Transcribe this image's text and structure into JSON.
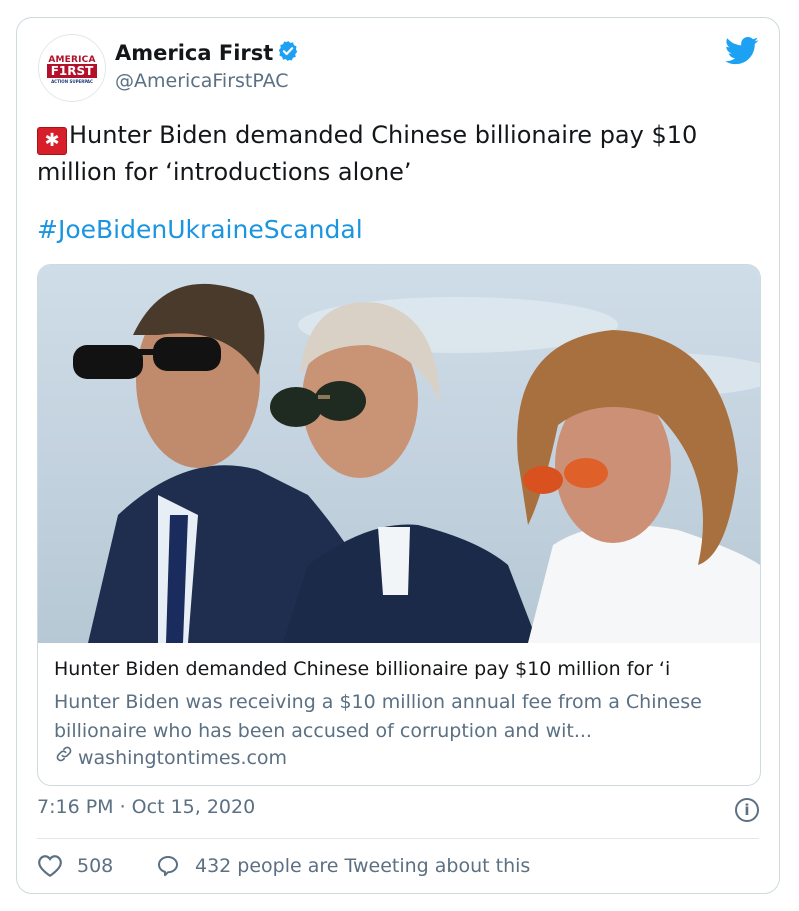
{
  "account": {
    "name": "America First",
    "handle": "@AmericaFirstPAC",
    "logo_top": "AMERICA",
    "logo_main": "F1RST",
    "logo_sub": "ACTION SUPERPAC"
  },
  "tweet": {
    "text": "Hunter Biden demanded Chinese billionaire pay $10 million for ‘introductions alone’",
    "hashtag": "#JoeBidenUkraineScandal",
    "timestamp": "7:16 PM · Oct 15, 2020"
  },
  "link_card": {
    "title": "Hunter Biden demanded Chinese billionaire pay $10 million for ‘i",
    "description": "Hunter Biden was receiving a $10 million annual fee from a Chinese billionaire who has been accused of corruption and wit...",
    "domain": "washingtontimes.com"
  },
  "engagement": {
    "likes": "508",
    "replies_text": "432 people are Tweeting about this"
  },
  "icons": {
    "verified": "verified-badge-icon",
    "platform": "twitter-bird-icon",
    "alert": "siren-emoji-icon",
    "link": "link-icon",
    "info": "info-icon",
    "like": "heart-icon",
    "reply": "speech-bubble-icon"
  },
  "colors": {
    "link_blue": "#1b95e0",
    "secondary_text": "#5b7083",
    "twitter_blue": "#1da1f2"
  }
}
